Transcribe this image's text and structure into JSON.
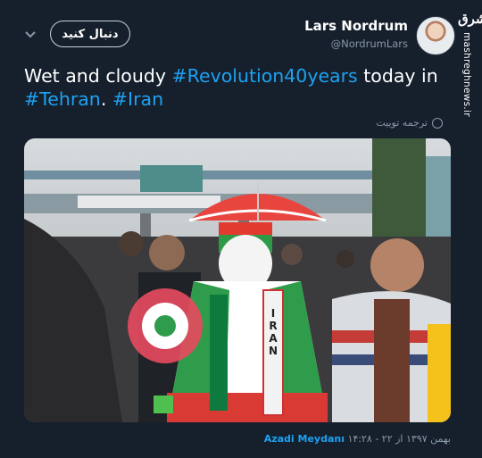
{
  "header": {
    "follow_label": "دنبال کنید",
    "display_name": "Lars Nordrum",
    "handle": "@NordrumLars"
  },
  "watermark": {
    "logo_text": "مشرق",
    "site": "mashreghnews.ir"
  },
  "tweet": {
    "text_1": "Wet and cloudy ",
    "tag_1": "#Revolution40years",
    "text_2": " today in",
    "tag_2": "#Tehran",
    "text_3": ". ",
    "tag_3": "#Iran"
  },
  "translate_label": "ترجمه توییت",
  "photo": {
    "sash_text": "IRAN"
  },
  "meta": {
    "timestamp": "۱۴:۲۸ - ۲۲ بهمن ۱۳۹۷ از",
    "location": "Azadi Meydanı"
  },
  "colors": {
    "accent": "#1da1f2",
    "bg": "#16202c",
    "muted": "#8899a6"
  }
}
